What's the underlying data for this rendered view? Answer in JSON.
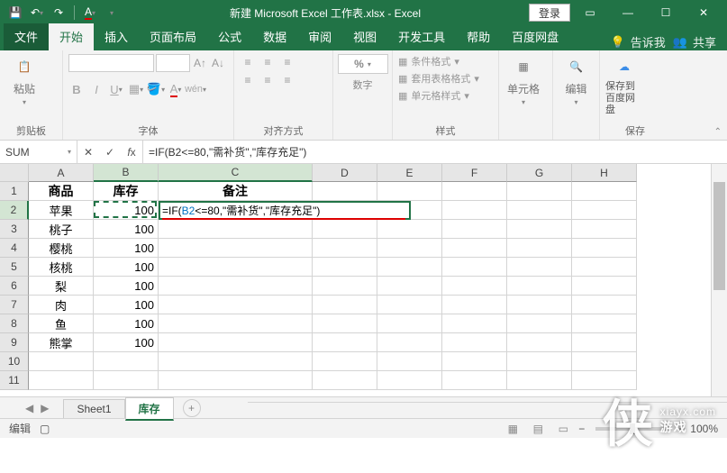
{
  "title": "新建 Microsoft Excel 工作表.xlsx - Excel",
  "login": "登录",
  "menu": {
    "file": "文件",
    "home": "开始",
    "insert": "插入",
    "layout": "页面布局",
    "formula": "公式",
    "data": "数据",
    "review": "审阅",
    "view": "视图",
    "dev": "开发工具",
    "help": "帮助",
    "baidu": "百度网盘",
    "tellme": "告诉我",
    "share": "共享"
  },
  "ribbon": {
    "clipboard": {
      "label": "剪贴板",
      "paste": "粘贴"
    },
    "font": {
      "label": "字体"
    },
    "align": {
      "label": "对齐方式"
    },
    "number": {
      "label": "数字",
      "pct": "%"
    },
    "styles": {
      "label": "样式",
      "cond": "条件格式",
      "table": "套用表格格式",
      "cell": "单元格样式"
    },
    "cells": {
      "label": "单元格"
    },
    "edit": {
      "label": "编辑"
    },
    "save": {
      "label": "保存",
      "btn": "保存到\n百度网盘"
    }
  },
  "namebox": "SUM",
  "formula": "=IF(B2<=80,\"需补货\",\"库存充足\")",
  "cols": [
    "A",
    "B",
    "C",
    "D",
    "E",
    "F",
    "G",
    "H"
  ],
  "rows": [
    "1",
    "2",
    "3",
    "4",
    "5",
    "6",
    "7",
    "8",
    "9",
    "10",
    "11"
  ],
  "headers": {
    "a": "商品",
    "b": "库存",
    "c": "备注"
  },
  "goods": [
    "苹果",
    "桃子",
    "樱桃",
    "核桃",
    "梨",
    "肉",
    "鱼",
    "熊掌"
  ],
  "stock": "100",
  "edit_prefix": "=IF(",
  "edit_ref": "B2",
  "edit_suffix": "<=80,\"需补货\",\"库存充足\")",
  "sheets": {
    "s1": "Sheet1",
    "s2": "库存"
  },
  "status": "编辑",
  "zoom": "100%",
  "chart_data": {
    "type": "table",
    "columns": [
      "商品",
      "库存",
      "备注"
    ],
    "rows": [
      [
        "苹果",
        100,
        "=IF(B2<=80,\"需补货\",\"库存充足\")"
      ],
      [
        "桃子",
        100,
        ""
      ],
      [
        "樱桃",
        100,
        ""
      ],
      [
        "核桃",
        100,
        ""
      ],
      [
        "梨",
        100,
        ""
      ],
      [
        "肉",
        100,
        ""
      ],
      [
        "鱼",
        100,
        ""
      ],
      [
        "熊掌",
        100,
        ""
      ]
    ]
  },
  "watermark": {
    "glyph": "侠",
    "line1": "xiayx.com",
    "line2": "游戏"
  }
}
